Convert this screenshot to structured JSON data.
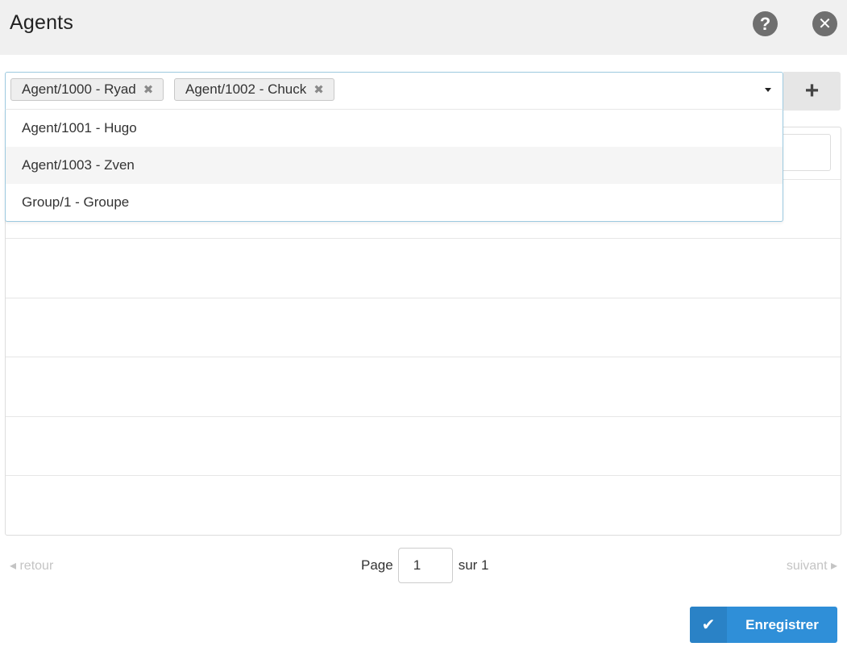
{
  "header": {
    "title": "Agents",
    "help_icon": "question-circle-icon",
    "close_icon": "times-circle-icon",
    "help_glyph": "?",
    "close_glyph": "✕"
  },
  "select": {
    "tags": [
      {
        "label": "Agent/1000 - Ryad",
        "remove": "✖"
      },
      {
        "label": "Agent/1002 - Chuck",
        "remove": "✖"
      }
    ],
    "add_glyph": "+",
    "options": [
      {
        "label": "Agent/1001 - Hugo"
      },
      {
        "label": "Agent/1003 - Zven"
      },
      {
        "label": "Group/1 - Groupe"
      }
    ]
  },
  "pagination": {
    "prev_label": "◂ retour",
    "next_label": "suivant ▸",
    "page_label": "Page",
    "page_value": "1",
    "of_label": "sur 1"
  },
  "save": {
    "label": "Enregistrer",
    "glyph": "✔"
  },
  "colors": {
    "header_bg": "#f0f0f0",
    "accent": "#2f8fd8",
    "select_border": "#9cc9df"
  }
}
